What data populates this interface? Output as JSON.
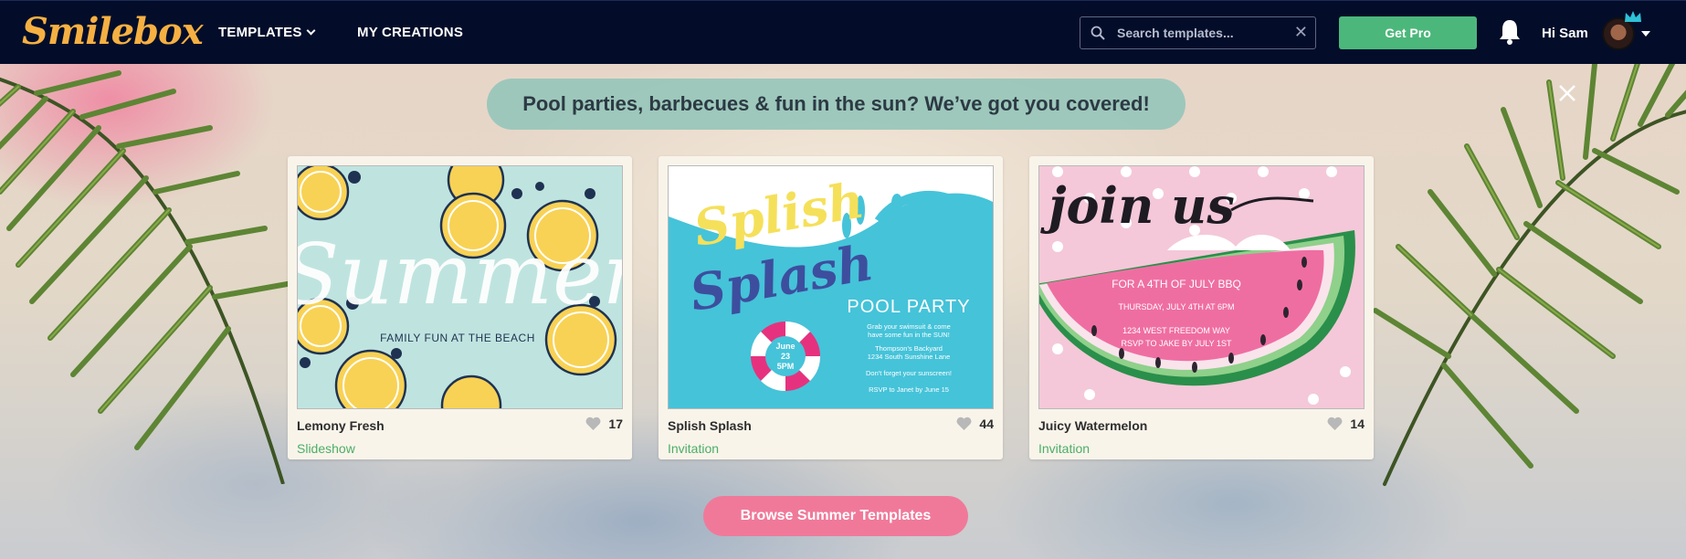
{
  "nav": {
    "logo": "Smilebox",
    "templates_label": "TEMPLATES",
    "creations_label": "MY CREATIONS",
    "search_placeholder": "Search templates...",
    "search_value": "",
    "clear_icon": "close-icon",
    "pro_label": "Get Pro",
    "greeting": "Hi Sam",
    "colors": {
      "bar": "#030d2a",
      "logo": "#f6b042",
      "pro": "#4cb77b"
    }
  },
  "hero": {
    "banner": "Pool parties, barbecues & fun in the sun? We’ve got you covered!",
    "browse_label": "Browse Summer Templates",
    "colors": {
      "banner": "#90c4b8",
      "browse": "#f0799a",
      "type_text": "#4cae66"
    }
  },
  "cards": [
    {
      "name": "Lemony Fresh",
      "type": "Slideshow",
      "likes": "17",
      "art": {
        "title": "Summer",
        "subtitle": "FAMILY FUN AT THE BEACH"
      }
    },
    {
      "name": "Splish Splash",
      "type": "Invitation",
      "likes": "44",
      "art": {
        "title_1": "Splish",
        "title_2": "Splash",
        "ring_1": "June",
        "ring_2": "23",
        "ring_3": "5PM",
        "heading": "POOL PARTY",
        "line_1": "Grab your swimsuit & come",
        "line_2": "have some fun in the SUN!",
        "line_3": "Thompson's Backyard",
        "line_4": "1234 South Sunshine Lane",
        "line_5": "Don't forget your sunscreen!",
        "line_6": "RSVP to Janet by June 15"
      }
    },
    {
      "name": "Juicy Watermelon",
      "type": "Invitation",
      "likes": "14",
      "art": {
        "title": "join us",
        "line_1": "FOR A 4TH OF JULY BBQ",
        "line_2": "THURSDAY, JULY 4TH AT 6PM",
        "line_3": "1234 WEST FREEDOM WAY",
        "line_4": "RSVP TO JAKE BY JULY 1ST"
      }
    }
  ]
}
